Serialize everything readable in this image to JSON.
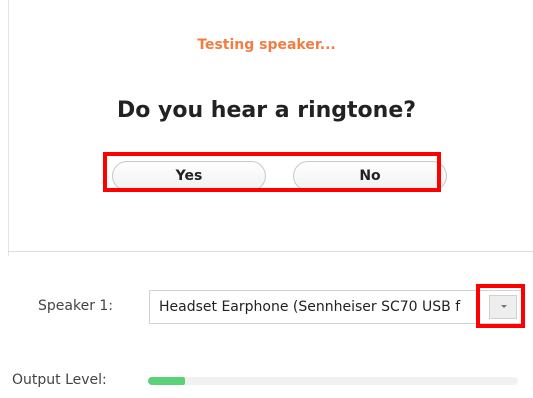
{
  "test": {
    "status": "Testing speaker...",
    "question": "Do you hear a ringtone?",
    "yes_label": "Yes",
    "no_label": "No"
  },
  "speaker": {
    "label": "Speaker 1:",
    "selected": "Headset Earphone (Sennheiser SC70 USB f"
  },
  "output": {
    "label": "Output Level:",
    "level_fraction": 0.1
  },
  "colors": {
    "status": "#f27d42",
    "highlight": "#ff0000",
    "meter_fill": "#5bd27a"
  },
  "icons": {
    "dropdown": "chevron-down-icon"
  }
}
